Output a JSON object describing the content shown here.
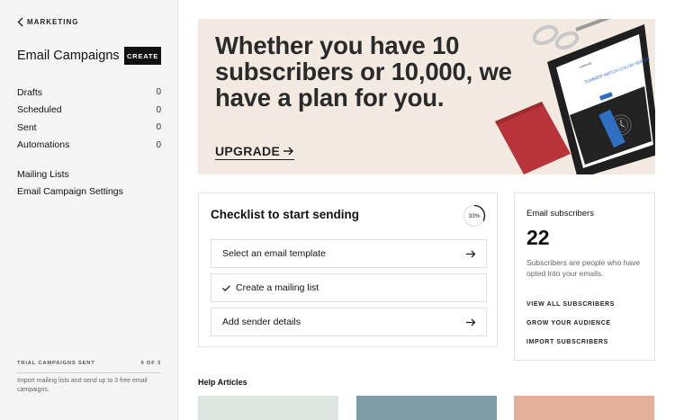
{
  "sidebar": {
    "back_label": "MARKETING",
    "title": "Email Campaigns",
    "create_label": "CREATE",
    "items": [
      {
        "label": "Drafts",
        "count": "0"
      },
      {
        "label": "Scheduled",
        "count": "0"
      },
      {
        "label": "Sent",
        "count": "0"
      },
      {
        "label": "Automations",
        "count": "0"
      }
    ],
    "links": [
      {
        "label": "Mailing Lists"
      },
      {
        "label": "Email Campaign Settings"
      }
    ],
    "trial": {
      "label": "TRIAL CAMPAIGNS SENT",
      "value": "0 OF 3",
      "progress_fraction": 0,
      "description": "Import mailing lists and send up to 3 free email campaigns."
    }
  },
  "banner": {
    "headline": "Whether you have 10 subscribers or 10,000, we have a plan for you.",
    "cta_label": "UPGRADE",
    "image_text": {
      "top_line": "Loremvie",
      "heading": "SUMMER WATCH COLOR SERIES",
      "button": "SHOP NOW"
    }
  },
  "checklist": {
    "title": "Checklist to start sending",
    "progress_label": "33%",
    "progress_fraction": 0.33,
    "tasks": [
      {
        "label": "Select an email template",
        "done": false
      },
      {
        "label": "Create a mailing list",
        "done": true
      },
      {
        "label": "Add sender details",
        "done": false
      }
    ]
  },
  "subscribers": {
    "title": "Email subscribers",
    "count": "22",
    "description": "Subscribers are people who have opted into your emails.",
    "links": [
      {
        "label": "VIEW ALL SUBSCRIBERS"
      },
      {
        "label": "GROW YOUR AUDIENCE"
      },
      {
        "label": "IMPORT SUBSCRIBERS"
      }
    ]
  },
  "help": {
    "title": "Help Articles",
    "cards": [
      {
        "color": "#dfe6e2"
      },
      {
        "color": "#7c9ca6"
      },
      {
        "color": "#e3b19b"
      }
    ]
  },
  "colors": {
    "sidebar_bg": "#f5f5f5",
    "banner_bg": "#f3ebe2",
    "button_dark": "#111111",
    "notebook_red": "#b8343a",
    "watch_blue": "#2f6fc3"
  },
  "icons": {
    "back": "chevron-left-icon",
    "arrow": "arrow-right-icon",
    "check": "check-icon"
  }
}
